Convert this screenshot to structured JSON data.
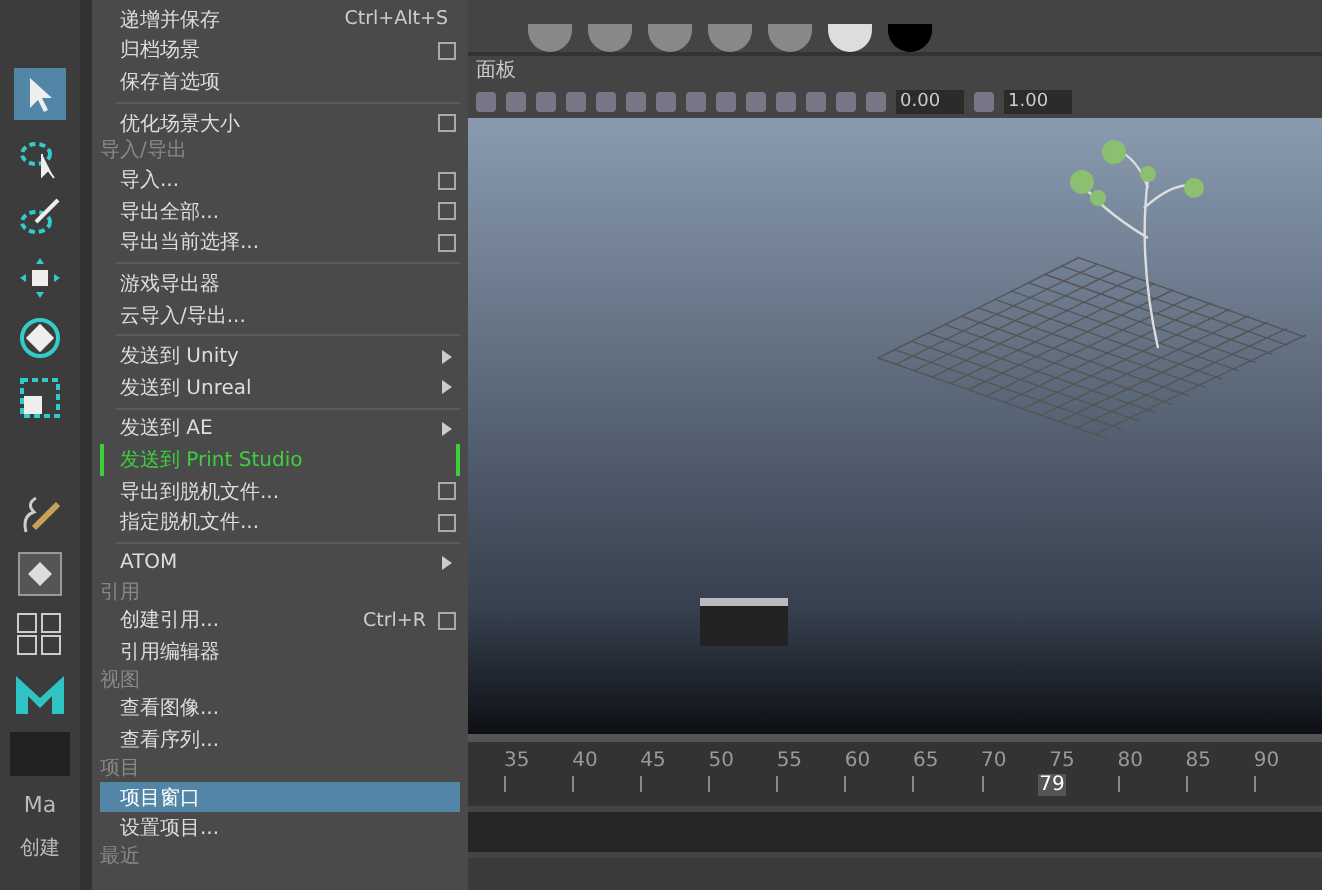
{
  "menu": {
    "items": [
      {
        "kind": "item",
        "label": "递增并保存",
        "shortcut": "Ctrl+Alt+S",
        "option_box": false,
        "submenu": false,
        "selected": false
      },
      {
        "kind": "item",
        "label": "归档场景",
        "option_box": true,
        "submenu": false,
        "selected": false
      },
      {
        "kind": "item",
        "label": "保存首选项",
        "option_box": false,
        "submenu": false,
        "selected": false
      },
      {
        "kind": "divider"
      },
      {
        "kind": "item",
        "label": "优化场景大小",
        "option_box": true,
        "submenu": false,
        "selected": false
      },
      {
        "kind": "header",
        "label": "导入/导出"
      },
      {
        "kind": "item",
        "label": "导入...",
        "option_box": true,
        "submenu": false,
        "selected": false
      },
      {
        "kind": "item",
        "label": "导出全部...",
        "option_box": true,
        "submenu": false,
        "selected": false
      },
      {
        "kind": "item",
        "label": "导出当前选择...",
        "option_box": true,
        "submenu": false,
        "selected": false
      },
      {
        "kind": "divider"
      },
      {
        "kind": "item",
        "label": "游戏导出器",
        "option_box": false,
        "submenu": false,
        "selected": false
      },
      {
        "kind": "item",
        "label": "云导入/导出...",
        "option_box": false,
        "submenu": false,
        "selected": false
      },
      {
        "kind": "divider"
      },
      {
        "kind": "item",
        "label": "发送到 Unity",
        "option_box": false,
        "submenu": true,
        "selected": false
      },
      {
        "kind": "item",
        "label": "发送到 Unreal",
        "option_box": false,
        "submenu": true,
        "selected": false
      },
      {
        "kind": "divider"
      },
      {
        "kind": "item",
        "label": "发送到 AE",
        "option_box": false,
        "submenu": true,
        "selected": false
      },
      {
        "kind": "highlight",
        "label": "发送到 Print Studio"
      },
      {
        "kind": "item",
        "label": "导出到脱机文件...",
        "option_box": true,
        "submenu": false,
        "selected": false
      },
      {
        "kind": "item",
        "label": "指定脱机文件...",
        "option_box": true,
        "submenu": false,
        "selected": false
      },
      {
        "kind": "divider"
      },
      {
        "kind": "item",
        "label": "ATOM",
        "option_box": false,
        "submenu": true,
        "selected": false
      },
      {
        "kind": "header",
        "label": "引用"
      },
      {
        "kind": "item",
        "label": "创建引用...",
        "shortcut": "Ctrl+R",
        "option_box": true,
        "submenu": false,
        "selected": false
      },
      {
        "kind": "item",
        "label": "引用编辑器",
        "option_box": false,
        "submenu": false,
        "selected": false
      },
      {
        "kind": "header",
        "label": "视图"
      },
      {
        "kind": "item",
        "label": "查看图像...",
        "option_box": false,
        "submenu": false,
        "selected": false
      },
      {
        "kind": "item",
        "label": "查看序列...",
        "option_box": false,
        "submenu": false,
        "selected": false
      },
      {
        "kind": "header",
        "label": "项目"
      },
      {
        "kind": "item",
        "label": "项目窗口",
        "option_box": false,
        "submenu": false,
        "selected": true
      },
      {
        "kind": "item",
        "label": "设置项目...",
        "option_box": false,
        "submenu": false,
        "selected": false
      },
      {
        "kind": "header",
        "label": "最近"
      }
    ]
  },
  "left_panel": {
    "texts": [
      "Ma",
      "创建"
    ]
  },
  "panel_menu": "面板",
  "fields": [
    "0.00",
    "1.00"
  ],
  "timeline": {
    "ticks": [
      "35",
      "40",
      "45",
      "50",
      "55",
      "60",
      "65",
      "70",
      "75",
      "80",
      "85",
      "90"
    ],
    "current_frame": "79"
  }
}
